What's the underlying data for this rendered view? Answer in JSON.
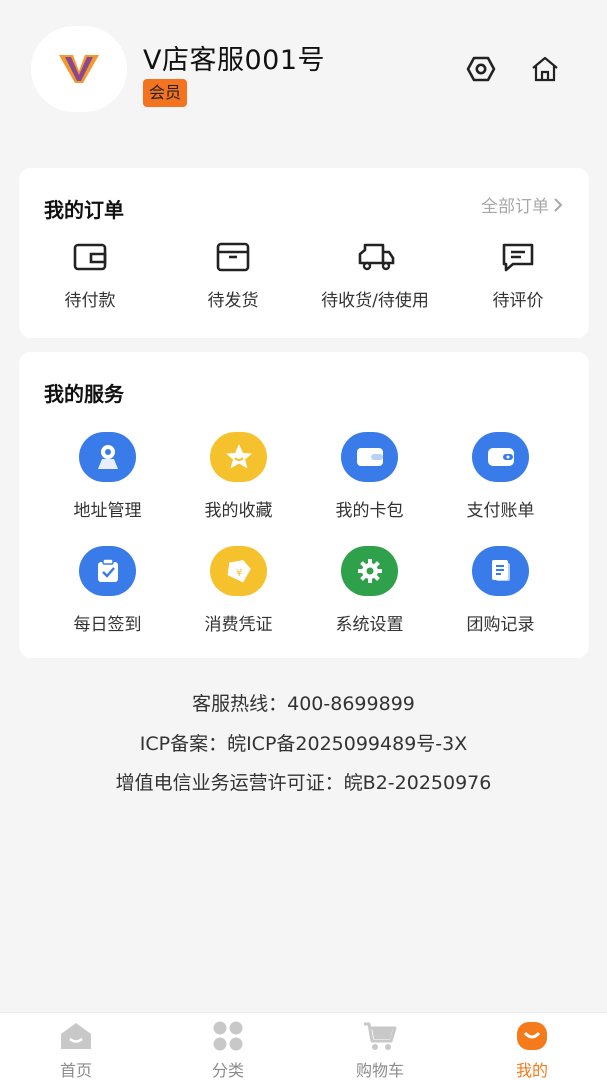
{
  "profile": {
    "username": "V店客服001号",
    "badge": "会员",
    "colors": {
      "badge": "#f4731f"
    }
  },
  "orders": {
    "title": "我的订单",
    "all_label": "全部订单",
    "items": [
      {
        "label": "待付款",
        "icon": "wallet-icon"
      },
      {
        "label": "待发货",
        "icon": "box-icon"
      },
      {
        "label": "待收货/待使用",
        "icon": "truck-icon"
      },
      {
        "label": "待评价",
        "icon": "comment-icon"
      }
    ]
  },
  "services": {
    "title": "我的服务",
    "items": [
      {
        "label": "地址管理",
        "icon": "location-icon",
        "color": "#3a7bea"
      },
      {
        "label": "我的收藏",
        "icon": "star-icon",
        "color": "#f5c12c"
      },
      {
        "label": "我的卡包",
        "icon": "card-wallet-icon",
        "color": "#3a7bea"
      },
      {
        "label": "支付账单",
        "icon": "payment-icon",
        "color": "#3a7bea"
      },
      {
        "label": "每日签到",
        "icon": "checkin-icon",
        "color": "#3a7bea"
      },
      {
        "label": "消费凭证",
        "icon": "receipt-tag-icon",
        "color": "#f5c12c"
      },
      {
        "label": "系统设置",
        "icon": "gear-icon",
        "color": "#2ea14a"
      },
      {
        "label": "团购记录",
        "icon": "document-icon",
        "color": "#3a7bea"
      }
    ]
  },
  "info": {
    "hotline": "客服热线：400-8699899",
    "icp": "ICP备案：皖ICP备2025099489号-3X",
    "license": "增值电信业务运营许可证：皖B2-20250976"
  },
  "tabbar": {
    "items": [
      {
        "label": "首页",
        "icon": "home-icon",
        "active": false
      },
      {
        "label": "分类",
        "icon": "category-icon",
        "active": false
      },
      {
        "label": "购物车",
        "icon": "cart-icon",
        "active": false
      },
      {
        "label": "我的",
        "icon": "profile-icon",
        "active": true
      }
    ],
    "colors": {
      "active": "#f47a1c",
      "inactive": "#c8c8c8"
    }
  }
}
